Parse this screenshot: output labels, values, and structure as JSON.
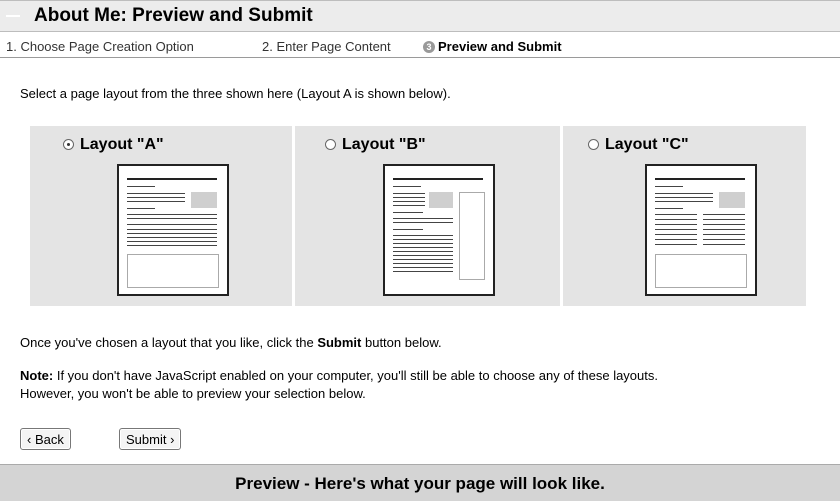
{
  "header": {
    "title": "About Me: Preview and Submit"
  },
  "steps": {
    "step1": "1. Choose Page Creation Option",
    "step2": "2. Enter Page Content",
    "step3_num": "3",
    "step3": "Preview and Submit"
  },
  "intro": "Select a page layout from the three shown here (Layout A is shown below).",
  "layouts": [
    {
      "label": "Layout \"A\"",
      "selected": true
    },
    {
      "label": "Layout \"B\"",
      "selected": false
    },
    {
      "label": "Layout \"C\"",
      "selected": false
    }
  ],
  "message": {
    "before": "Once you've chosen a layout that you like, click the ",
    "bold": "Submit",
    "after": " button below."
  },
  "note": {
    "label": "Note:",
    "line1": " If you don't have JavaScript enabled on your computer, you'll still be able to choose any of these layouts.",
    "line2": "However, you won't be able to preview your selection below."
  },
  "buttons": {
    "back": "‹ Back",
    "submit": "Submit ›"
  },
  "preview": {
    "title": "Preview - Here's what your page will look like."
  }
}
